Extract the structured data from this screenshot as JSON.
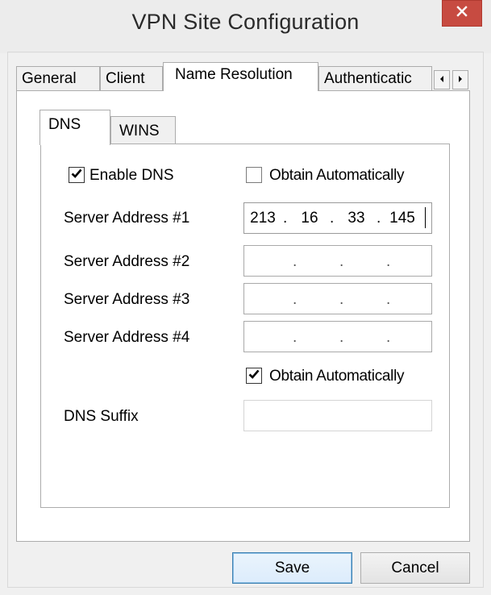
{
  "window": {
    "title": "VPN Site Configuration",
    "close_icon": "close-icon",
    "close_color": "#c74b41"
  },
  "tabs": [
    {
      "label": "General",
      "active": false
    },
    {
      "label": "Client",
      "active": false
    },
    {
      "label": "Name Resolution",
      "active": true
    },
    {
      "label": "Authenticatic",
      "active": false
    }
  ],
  "tab_scroll": {
    "left_icon": "arrow-left-icon",
    "right_icon": "arrow-right-icon"
  },
  "subtabs": [
    {
      "label": "DNS",
      "active": true
    },
    {
      "label": "WINS",
      "active": false
    }
  ],
  "dns": {
    "enable_label": "Enable DNS",
    "enable_checked": true,
    "obtain_auto_top_label": "Obtain Automatically",
    "obtain_auto_top_checked": false,
    "servers": [
      {
        "label": "Server Address #1",
        "octets": [
          "213",
          "16",
          "33",
          "145"
        ]
      },
      {
        "label": "Server Address #2",
        "octets": [
          "",
          "",
          "",
          ""
        ]
      },
      {
        "label": "Server Address #3",
        "octets": [
          "",
          "",
          "",
          ""
        ]
      },
      {
        "label": "Server Address #4",
        "octets": [
          "",
          "",
          "",
          ""
        ]
      }
    ],
    "obtain_auto_bottom_label": "Obtain Automatically",
    "obtain_auto_bottom_checked": true,
    "suffix_label": "DNS Suffix",
    "suffix_value": ""
  },
  "buttons": {
    "save_label": "Save",
    "cancel_label": "Cancel"
  }
}
